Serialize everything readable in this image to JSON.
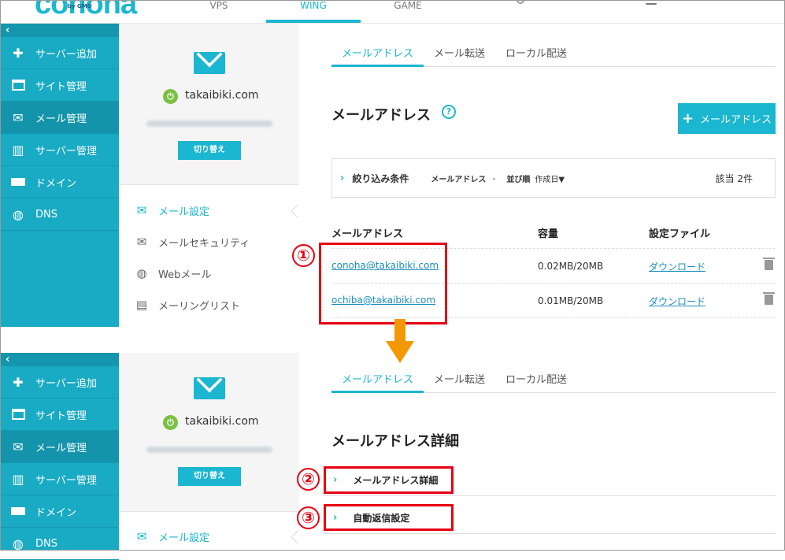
{
  "header": {
    "logo_text": "conoha",
    "logo_sub": "by GMO",
    "nav": [
      "VPS",
      "WING",
      "GAME"
    ],
    "active_nav": "WING"
  },
  "sidebar": {
    "collapse": "‹",
    "items": [
      {
        "label": "サーバー追加",
        "icon": "plus-icon"
      },
      {
        "label": "サイト管理",
        "icon": "window-icon"
      },
      {
        "label": "メール管理",
        "icon": "mail-icon"
      },
      {
        "label": "サーバー管理",
        "icon": "server-icon"
      },
      {
        "label": "ドメイン",
        "icon": "domain-icon"
      },
      {
        "label": "DNS",
        "icon": "globe-icon"
      }
    ]
  },
  "account": {
    "domain": "takaibiki.com",
    "switch_label": "切り替え"
  },
  "submenu": [
    {
      "label": "メール設定",
      "icon": "mail-settings-icon"
    },
    {
      "label": "メールセキュリティ",
      "icon": "mail-security-icon"
    },
    {
      "label": "Webメール",
      "icon": "webmail-icon"
    },
    {
      "label": "メーリングリスト",
      "icon": "mailing-list-icon"
    }
  ],
  "tabs": [
    "メールアドレス",
    "メール転送",
    "ローカル配送"
  ],
  "list": {
    "title": "メールアドレス",
    "help": "?",
    "add_button": "メールアドレス",
    "filter": {
      "label": "絞り込み条件",
      "field": "メールアドレス",
      "field_value": "-",
      "sort_label": "並び順",
      "sort_value": "作成日▼",
      "count": "該当 2件"
    },
    "columns": [
      "メールアドレス",
      "容量",
      "設定ファイル"
    ],
    "rows": [
      {
        "address": "conoha@takaibiki.com",
        "size": "0.02MB/20MB",
        "file": "ダウンロード"
      },
      {
        "address": "ochiba@takaibiki.com",
        "size": "0.01MB/20MB",
        "file": "ダウンロード"
      }
    ]
  },
  "detail": {
    "title": "メールアドレス詳細",
    "sections": [
      "メールアドレス詳細",
      "自動返信設定"
    ]
  },
  "annotations": {
    "step1": "①",
    "step2": "②",
    "step3": "③",
    "box_color": "#e60012",
    "arrow_color": "#f39800"
  },
  "colors": {
    "accent": "#1bb6d0",
    "sidebar": "#19aac4",
    "power": "#7ac143"
  }
}
